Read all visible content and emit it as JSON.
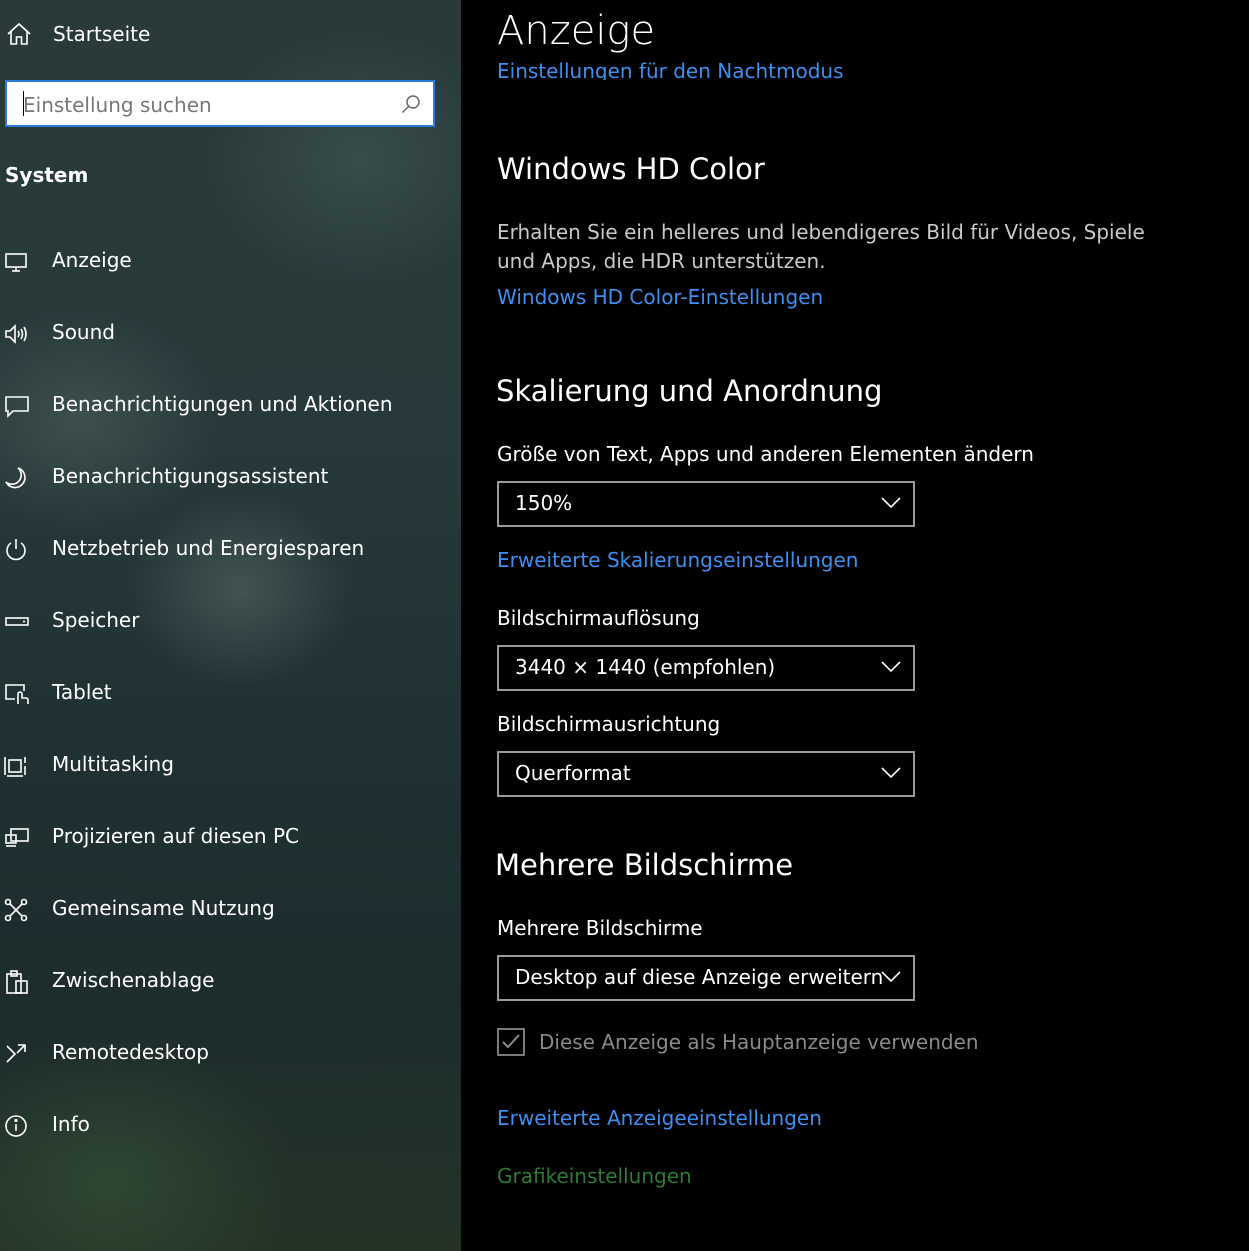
{
  "sidebar": {
    "home_label": "Startseite",
    "search_placeholder": "Einstellung suchen",
    "section_title": "System",
    "items": [
      {
        "label": "Anzeige",
        "icon": "monitor-icon"
      },
      {
        "label": "Sound",
        "icon": "speaker-icon"
      },
      {
        "label": "Benachrichtigungen und Aktionen",
        "icon": "notification-icon"
      },
      {
        "label": "Benachrichtigungsassistent",
        "icon": "moon-icon"
      },
      {
        "label": "Netzbetrieb und Energiesparen",
        "icon": "power-icon"
      },
      {
        "label": "Speicher",
        "icon": "storage-icon"
      },
      {
        "label": "Tablet",
        "icon": "tablet-icon"
      },
      {
        "label": "Multitasking",
        "icon": "multitasking-icon"
      },
      {
        "label": "Projizieren auf diesen PC",
        "icon": "project-icon"
      },
      {
        "label": "Gemeinsame Nutzung",
        "icon": "share-icon"
      },
      {
        "label": "Zwischenablage",
        "icon": "clipboard-icon"
      },
      {
        "label": "Remotedesktop",
        "icon": "remote-desktop-icon"
      },
      {
        "label": "Info",
        "icon": "info-icon"
      }
    ]
  },
  "main": {
    "title": "Anzeige",
    "night_link": "Einstellungen für den Nachtmodus",
    "hd_color": {
      "heading": "Windows HD Color",
      "description": "Erhalten Sie ein helleres und lebendigeres Bild für Videos, Spiele und Apps, die HDR unterstützen.",
      "link": "Windows HD Color-Einstellungen"
    },
    "scaling": {
      "heading": "Skalierung und Anordnung",
      "size_label": "Größe von Text, Apps und anderen Elementen ändern",
      "size_value": "150%",
      "advanced_link": "Erweiterte Skalierungseinstellungen",
      "resolution_label": "Bildschirmauflösung",
      "resolution_value": "3440 × 1440 (empfohlen)",
      "orientation_label": "Bildschirmausrichtung",
      "orientation_value": "Querformat"
    },
    "multi": {
      "heading": "Mehrere Bildschirme",
      "label": "Mehrere Bildschirme",
      "value": "Desktop auf diese Anzeige erweitern",
      "checkbox_label": "Diese Anzeige als Hauptanzeige verwenden",
      "advanced_link": "Erweiterte Anzeigeeinstellungen",
      "graphics_link": "Grafikeinstellungen"
    }
  }
}
